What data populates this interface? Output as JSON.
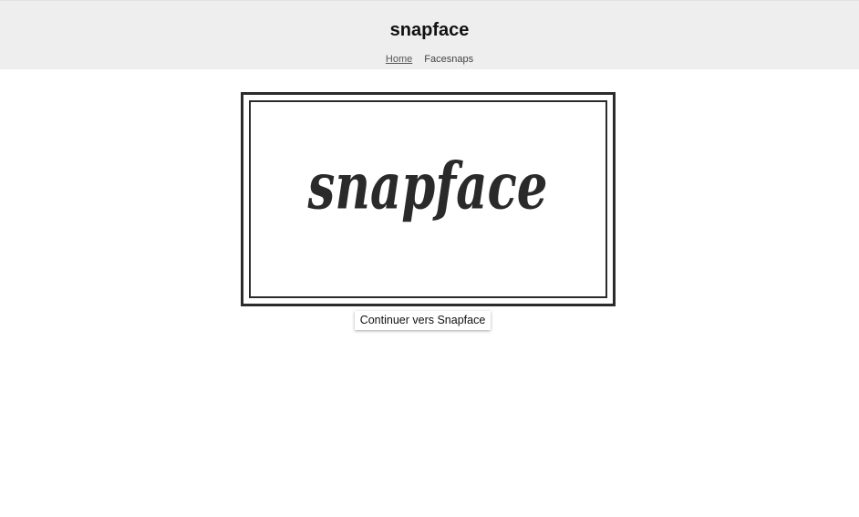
{
  "header": {
    "brand": "snapface",
    "nav": [
      {
        "label": "Home",
        "active": true
      },
      {
        "label": "Facesnaps",
        "active": false
      }
    ]
  },
  "main": {
    "logo": {
      "text": "snapface",
      "color": "#2a2a2a"
    },
    "continue_label": "Continuer vers Snapface"
  },
  "colors": {
    "header_bg": "#eeeeee",
    "page_bg": "#ffffff",
    "frame": "#2b2b2b"
  }
}
